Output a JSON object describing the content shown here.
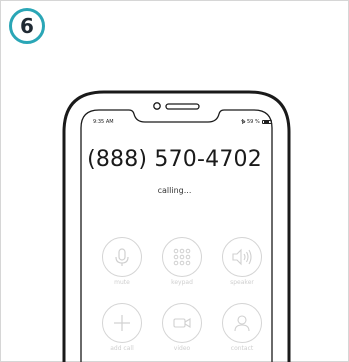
{
  "step": {
    "number": "6"
  },
  "status_bar": {
    "time": "9:35 AM",
    "battery": "59 %",
    "bluetooth_icon": "bluetooth-icon",
    "battery_icon": "battery-icon"
  },
  "call": {
    "number": "(888) 570-4702",
    "status": "calling..."
  },
  "buttons": [
    {
      "label": "mute",
      "icon": "microphone-icon"
    },
    {
      "label": "keypad",
      "icon": "keypad-icon"
    },
    {
      "label": "speaker",
      "icon": "speaker-icon"
    },
    {
      "label": "add call",
      "icon": "plus-icon"
    },
    {
      "label": "video",
      "icon": "video-camera-icon"
    },
    {
      "label": "contact",
      "icon": "contact-icon"
    }
  ],
  "colors": {
    "badge_ring": "#2aa6b6",
    "phone_outline": "#1a1a1a",
    "button_ring": "#d5d5d5",
    "button_label": "#cfcfcf"
  }
}
